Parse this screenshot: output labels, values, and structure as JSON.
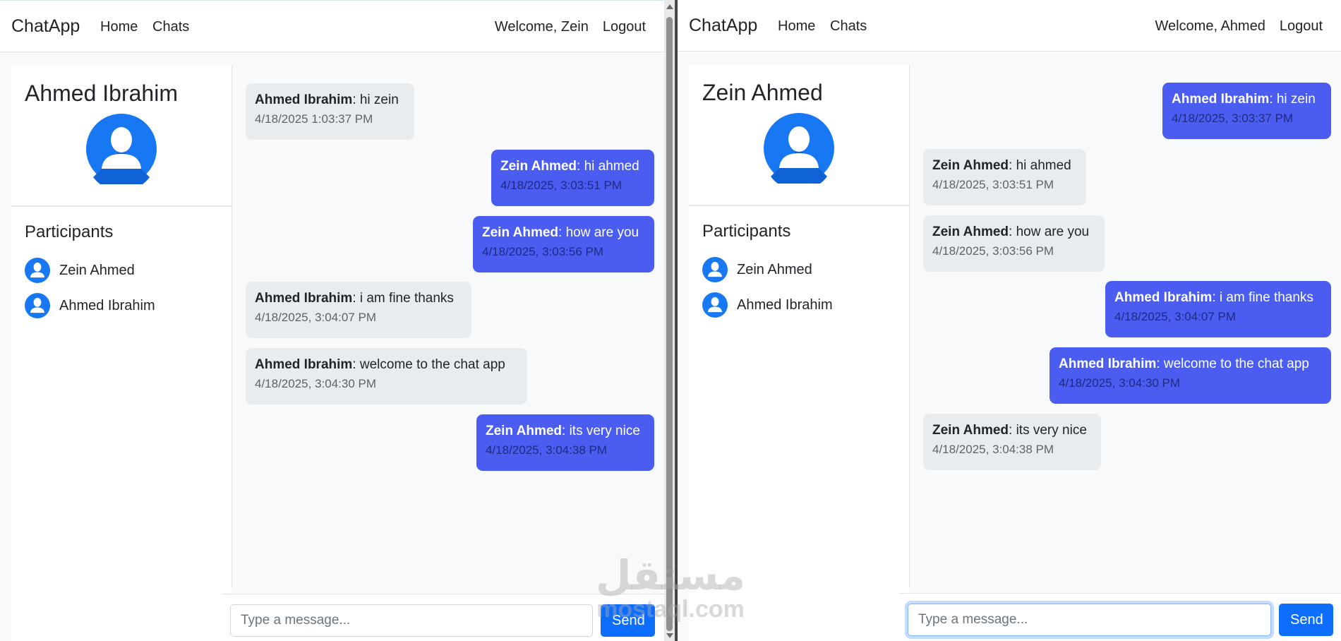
{
  "left_window": {
    "navbar": {
      "brand": "ChatApp",
      "home": "Home",
      "chats": "Chats",
      "welcome": "Welcome, Zein",
      "logout": "Logout"
    },
    "sidebar": {
      "profile_name": "Ahmed Ibrahim",
      "participants_title": "Participants",
      "participants": [
        "Zein Ahmed",
        "Ahmed Ibrahim"
      ]
    },
    "messages": [
      {
        "sender": "Ahmed Ibrahim",
        "text": ": hi zein",
        "time": "4/18/2025 1:03:37 PM",
        "mine": false
      },
      {
        "sender": "Zein Ahmed",
        "text": ": hi ahmed",
        "time": "4/18/2025, 3:03:51 PM",
        "mine": true
      },
      {
        "sender": "Zein Ahmed",
        "text": ": how are you",
        "time": "4/18/2025, 3:03:56 PM",
        "mine": true
      },
      {
        "sender": "Ahmed Ibrahim",
        "text": ": i am fine thanks",
        "time": "4/18/2025, 3:04:07 PM",
        "mine": false
      },
      {
        "sender": "Ahmed Ibrahim",
        "text": ": welcome to the chat app",
        "time": "4/18/2025, 3:04:30 PM",
        "mine": false
      },
      {
        "sender": "Zein Ahmed",
        "text": ": its very nice",
        "time": "4/18/2025, 3:04:38 PM",
        "mine": true
      }
    ],
    "input": {
      "placeholder": "Type a message...",
      "value": ""
    },
    "send_label": "Send"
  },
  "right_window": {
    "navbar": {
      "brand": "ChatApp",
      "home": "Home",
      "chats": "Chats",
      "welcome": "Welcome, Ahmed",
      "logout": "Logout"
    },
    "sidebar": {
      "profile_name": "Zein Ahmed",
      "participants_title": "Participants",
      "participants": [
        "Zein Ahmed",
        "Ahmed Ibrahim"
      ]
    },
    "messages": [
      {
        "sender": "Ahmed Ibrahim",
        "text": ": hi zein",
        "time": "4/18/2025, 3:03:37 PM",
        "mine": true
      },
      {
        "sender": "Zein Ahmed",
        "text": ": hi ahmed",
        "time": "4/18/2025, 3:03:51 PM",
        "mine": false
      },
      {
        "sender": "Zein Ahmed",
        "text": ": how are you",
        "time": "4/18/2025, 3:03:56 PM",
        "mine": false
      },
      {
        "sender": "Ahmed Ibrahim",
        "text": ": i am fine thanks",
        "time": "4/18/2025, 3:04:07 PM",
        "mine": true
      },
      {
        "sender": "Ahmed Ibrahim",
        "text": ": welcome to the chat app",
        "time": "4/18/2025, 3:04:30 PM",
        "mine": true
      },
      {
        "sender": "Zein Ahmed",
        "text": ": its very nice",
        "time": "4/18/2025, 3:04:38 PM",
        "mine": false
      }
    ],
    "input": {
      "placeholder": "Type a message...",
      "value": ""
    },
    "send_label": "Send"
  },
  "watermark": {
    "arabic": "مستقل",
    "latin": "mostaql.com"
  },
  "colors": {
    "mine_bubble": "#4a5df0",
    "other_bubble": "#e9ecef",
    "primary": "#0d6efd",
    "avatar": "#1877f2"
  },
  "icons": {
    "avatar": "user-avatar-icon"
  }
}
